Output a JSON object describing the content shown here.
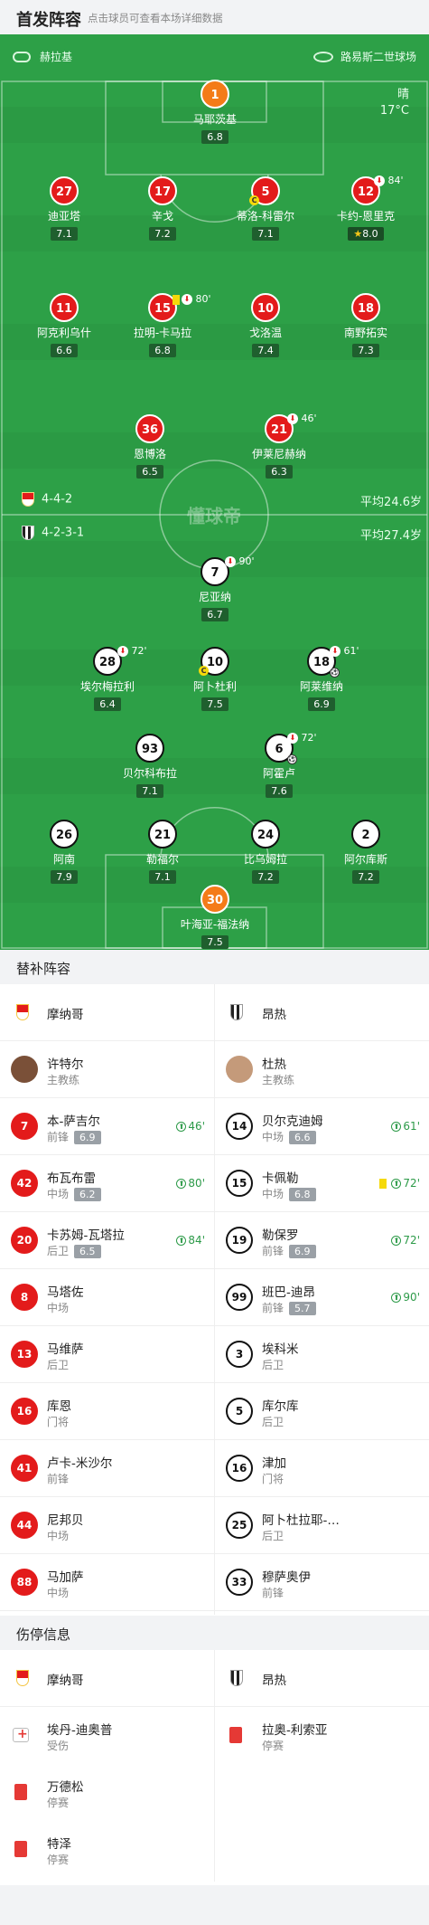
{
  "header": {
    "title": "首发阵容",
    "subtitle": "点击球员可查看本场详细数据"
  },
  "venue": {
    "referee": "赫拉基",
    "stadium": "路易斯二世球场",
    "weather": "晴",
    "temperature": "17°C"
  },
  "home": {
    "name": "摩纳哥",
    "formation": "4-4-2",
    "avg_age": "平均24.6岁",
    "players": [
      {
        "num": "1",
        "name": "马耶茨基",
        "rating": "6.8"
      },
      {
        "num": "27",
        "name": "迪亚塔",
        "rating": "7.1"
      },
      {
        "num": "17",
        "name": "辛戈",
        "rating": "7.2"
      },
      {
        "num": "5",
        "name": "蒂洛-科雷尔",
        "rating": "7.1"
      },
      {
        "num": "12",
        "name": "卡约-恩里克",
        "rating": "8.0",
        "event": "84'"
      },
      {
        "num": "11",
        "name": "阿克利乌什",
        "rating": "6.6"
      },
      {
        "num": "15",
        "name": "拉明-卡马拉",
        "rating": "6.8",
        "event": "80'"
      },
      {
        "num": "10",
        "name": "戈洛温",
        "rating": "7.4"
      },
      {
        "num": "18",
        "name": "南野拓实",
        "rating": "7.3"
      },
      {
        "num": "36",
        "name": "恩博洛",
        "rating": "6.5"
      },
      {
        "num": "21",
        "name": "伊莱尼赫纳",
        "rating": "6.3",
        "event": "46'"
      }
    ]
  },
  "away": {
    "name": "昂热",
    "formation": "4-2-3-1",
    "avg_age": "平均27.4岁",
    "players": [
      {
        "num": "7",
        "name": "尼亚纳",
        "rating": "6.7",
        "event": "90'"
      },
      {
        "num": "28",
        "name": "埃尔梅拉利",
        "rating": "6.4",
        "event": "72'"
      },
      {
        "num": "10",
        "name": "阿卜杜利",
        "rating": "7.5"
      },
      {
        "num": "18",
        "name": "阿莱维纳",
        "rating": "6.9",
        "event": "61'"
      },
      {
        "num": "93",
        "name": "贝尔科布拉",
        "rating": "7.1"
      },
      {
        "num": "6",
        "name": "阿霍卢",
        "rating": "7.6",
        "event": "72'"
      },
      {
        "num": "26",
        "name": "阿南",
        "rating": "7.9"
      },
      {
        "num": "21",
        "name": "勒福尔",
        "rating": "7.1"
      },
      {
        "num": "24",
        "name": "比乌姆拉",
        "rating": "7.2"
      },
      {
        "num": "2",
        "name": "阿尔库斯",
        "rating": "7.2"
      },
      {
        "num": "30",
        "name": "叶海亚-福法纳",
        "rating": "7.5"
      }
    ]
  },
  "watermark": "懂球帝",
  "subs": {
    "title": "替补阵容",
    "home_team": "摩纳哥",
    "away_team": "昂热",
    "home_coach": {
      "name": "许特尔",
      "role": "主教练"
    },
    "away_coach": {
      "name": "杜热",
      "role": "主教练"
    },
    "home": [
      {
        "num": "7",
        "name": "本-萨吉尔",
        "pos": "前锋",
        "rating": "6.9",
        "time": "46'"
      },
      {
        "num": "42",
        "name": "布瓦布雷",
        "pos": "中场",
        "rating": "6.2",
        "time": "80'"
      },
      {
        "num": "20",
        "name": "卡苏姆-瓦塔拉",
        "pos": "后卫",
        "rating": "6.5",
        "time": "84'"
      },
      {
        "num": "8",
        "name": "马塔佐",
        "pos": "中场"
      },
      {
        "num": "13",
        "name": "马维萨",
        "pos": "后卫"
      },
      {
        "num": "16",
        "name": "库恩",
        "pos": "门将"
      },
      {
        "num": "41",
        "name": "卢卡-米沙尔",
        "pos": "前锋"
      },
      {
        "num": "44",
        "name": "尼邦贝",
        "pos": "中场"
      },
      {
        "num": "88",
        "name": "马加萨",
        "pos": "中场"
      }
    ],
    "away": [
      {
        "num": "14",
        "name": "贝尔克迪姆",
        "pos": "中场",
        "rating": "6.6",
        "time": "61'"
      },
      {
        "num": "15",
        "name": "卡佩勒",
        "pos": "中场",
        "rating": "6.8",
        "time": "72'"
      },
      {
        "num": "19",
        "name": "勒保罗",
        "pos": "前锋",
        "rating": "6.9",
        "time": "72'"
      },
      {
        "num": "99",
        "name": "班巴-迪昂",
        "pos": "前锋",
        "rating": "5.7",
        "time": "90'"
      },
      {
        "num": "3",
        "name": "埃科米",
        "pos": "后卫"
      },
      {
        "num": "5",
        "name": "库尔库",
        "pos": "后卫"
      },
      {
        "num": "16",
        "name": "津加",
        "pos": "门将"
      },
      {
        "num": "25",
        "name": "阿卜杜拉耶-…",
        "pos": "后卫"
      },
      {
        "num": "33",
        "name": "穆萨奥伊",
        "pos": "前锋"
      }
    ]
  },
  "injuries": {
    "title": "伤停信息",
    "home_team": "摩纳哥",
    "away_team": "昂热",
    "home": [
      {
        "name": "埃丹-迪奥普",
        "status": "受伤",
        "type": "injury"
      },
      {
        "name": "万德松",
        "status": "停赛",
        "type": "suspension"
      },
      {
        "name": "特泽",
        "status": "停赛",
        "type": "suspension"
      }
    ],
    "away": [
      {
        "name": "拉奥-利索亚",
        "status": "停赛",
        "type": "suspension"
      }
    ]
  },
  "colors": {
    "pitch": "#2da047",
    "home": "#e31b1b",
    "gk_home": "#f47b18",
    "section_bg": "#f2f3f5",
    "sub_in": "#2c9a48"
  }
}
